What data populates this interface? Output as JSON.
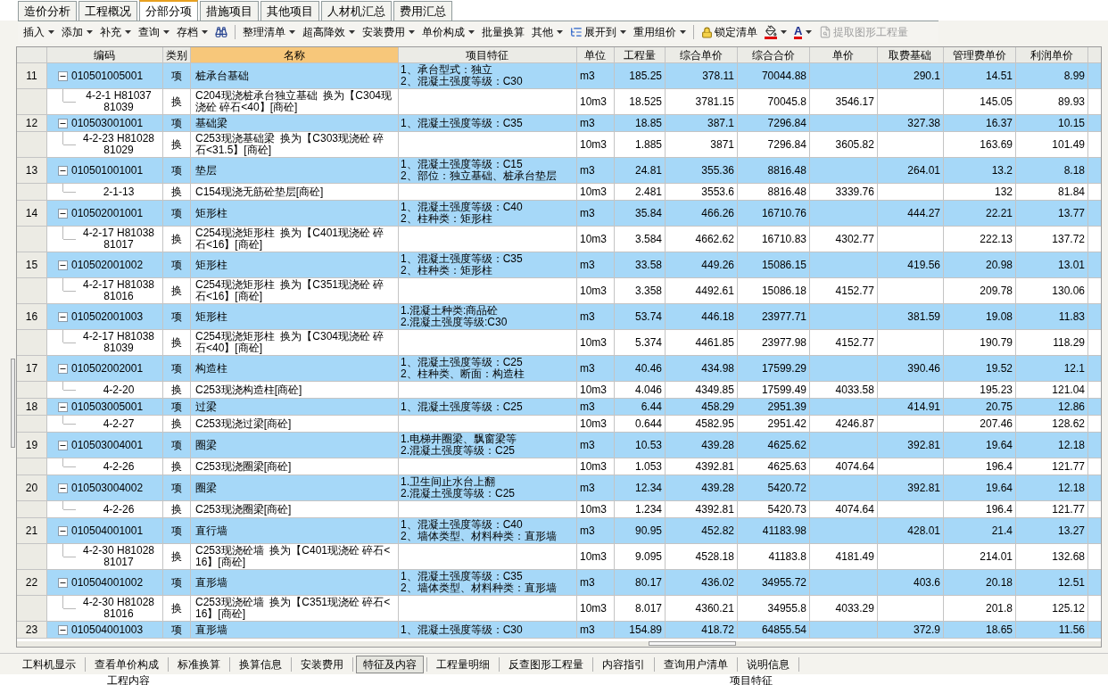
{
  "tabs": [
    {
      "label": "造价分析",
      "selected": false
    },
    {
      "label": "工程概况",
      "selected": false
    },
    {
      "label": "分部分项",
      "selected": true
    },
    {
      "label": "措施项目",
      "selected": false
    },
    {
      "label": "其他项目",
      "selected": false
    },
    {
      "label": "人材机汇总",
      "selected": false
    },
    {
      "label": "费用汇总",
      "selected": false
    }
  ],
  "toolbar": [
    {
      "kind": "text",
      "label": "插入",
      "menu": true
    },
    {
      "kind": "text",
      "label": "添加",
      "menu": true
    },
    {
      "kind": "text",
      "label": "补充",
      "menu": true
    },
    {
      "kind": "text",
      "label": "查询",
      "menu": true
    },
    {
      "kind": "text",
      "label": "存档",
      "menu": true
    },
    {
      "kind": "find",
      "menu": false
    },
    {
      "kind": "separator"
    },
    {
      "kind": "text",
      "label": "整理清单",
      "menu": true
    },
    {
      "kind": "text",
      "label": "超高降效",
      "menu": true
    },
    {
      "kind": "text",
      "label": "安装费用",
      "menu": true
    },
    {
      "kind": "text",
      "label": "单价构成",
      "menu": true
    },
    {
      "kind": "text",
      "label": "批量换算",
      "menu": false
    },
    {
      "kind": "text",
      "label": "其他",
      "menu": true
    },
    {
      "kind": "expand",
      "label": "展开到",
      "menu": true
    },
    {
      "kind": "text",
      "label": "重用组价",
      "menu": true
    },
    {
      "kind": "separator"
    },
    {
      "kind": "lock",
      "label": "锁定清单",
      "menu": false
    },
    {
      "kind": "fill-color",
      "menu": true
    },
    {
      "kind": "font-color",
      "label": "A",
      "menu": true
    },
    {
      "kind": "extract",
      "label": "提取图形工程量",
      "menu": false,
      "disabled": true
    }
  ],
  "table": {
    "columns": [
      {
        "selected": false
      },
      {
        "label": "编码",
        "selected": false
      },
      {
        "label": "类别",
        "selected": false
      },
      {
        "label": "名称",
        "selected": true
      },
      {
        "label": "项目特征",
        "selected": false
      },
      {
        "label": "单位",
        "selected": false
      },
      {
        "label": "工程量",
        "selected": false
      },
      {
        "label": "综合单价",
        "selected": false
      },
      {
        "label": "综合合价",
        "selected": false
      },
      {
        "label": "单价",
        "selected": false
      },
      {
        "label": "取费基础",
        "selected": false
      },
      {
        "label": "管理费单价",
        "selected": false
      },
      {
        "label": "利润单价",
        "selected": false
      }
    ],
    "rows": [
      {
        "number": "11",
        "code": "010501005001",
        "type": "项",
        "name": "桩承台基础",
        "features": [
          "1、承台型式：独立",
          "2、混凝土强度等级：C30"
        ],
        "unit": "m3",
        "quantity": "185.25",
        "unit_price": "378.11",
        "total": "70044.88",
        "fee_base": "290.1",
        "mgmt_fee": "14.51",
        "profit": "8.99",
        "expanded": true,
        "children": [
          {
            "code": "4-2-1 H81037 81039",
            "type": "换",
            "name": "C204现浇桩承台独立基础  换为【C304现浇砼 碎石<40】[商砼]",
            "unit": "10m3",
            "quantity": "18.525",
            "unit_price": "3781.15",
            "total": "70045.8",
            "price": "3546.17",
            "mgmt_fee": "145.05",
            "profit": "89.93"
          }
        ]
      },
      {
        "number": "12",
        "code": "010503001001",
        "type": "项",
        "name": "基础梁",
        "features": [
          "1、混凝土强度等级：C35"
        ],
        "unit": "m3",
        "quantity": "18.85",
        "unit_price": "387.1",
        "total": "7296.84",
        "fee_base": "327.38",
        "mgmt_fee": "16.37",
        "profit": "10.15",
        "expanded": true,
        "children": [
          {
            "code": "4-2-23 H81028 81029",
            "type": "换",
            "name": "C253现浇基础梁  换为【C303现浇砼 碎石<31.5】[商砼]",
            "unit": "10m3",
            "quantity": "1.885",
            "unit_price": "3871",
            "total": "7296.84",
            "price": "3605.82",
            "mgmt_fee": "163.69",
            "profit": "101.49"
          }
        ]
      },
      {
        "number": "13",
        "code": "010501001001",
        "type": "项",
        "name": "垫层",
        "features": [
          "1、混凝土强度等级：C15",
          "2、部位：独立基础、桩承台垫层"
        ],
        "unit": "m3",
        "quantity": "24.81",
        "unit_price": "355.36",
        "total": "8816.48",
        "fee_base": "264.01",
        "mgmt_fee": "13.2",
        "profit": "8.18",
        "expanded": true,
        "children": [
          {
            "code": "2-1-13",
            "type": "换",
            "name": "C154现浇无筋砼垫层[商砼]",
            "unit": "10m3",
            "quantity": "2.481",
            "unit_price": "3553.6",
            "total": "8816.48",
            "price": "3339.76",
            "mgmt_fee": "132",
            "profit": "81.84"
          }
        ]
      },
      {
        "number": "14",
        "code": "010502001001",
        "type": "项",
        "name": "矩形柱",
        "features": [
          "1、混凝土强度等级：C40",
          "2、柱种类：矩形柱"
        ],
        "unit": "m3",
        "quantity": "35.84",
        "unit_price": "466.26",
        "total": "16710.76",
        "fee_base": "444.27",
        "mgmt_fee": "22.21",
        "profit": "13.77",
        "expanded": true,
        "children": [
          {
            "code": "4-2-17 H81038 81017",
            "type": "换",
            "name": "C254现浇矩形柱  换为【C401现浇砼 碎石<16】[商砼]",
            "unit": "10m3",
            "quantity": "3.584",
            "unit_price": "4662.62",
            "total": "16710.83",
            "price": "4302.77",
            "mgmt_fee": "222.13",
            "profit": "137.72"
          }
        ]
      },
      {
        "number": "15",
        "code": "010502001002",
        "type": "项",
        "name": "矩形柱",
        "features": [
          "1、混凝土强度等级：C35",
          "2、柱种类：矩形柱"
        ],
        "unit": "m3",
        "quantity": "33.58",
        "unit_price": "449.26",
        "total": "15086.15",
        "fee_base": "419.56",
        "mgmt_fee": "20.98",
        "profit": "13.01",
        "expanded": true,
        "children": [
          {
            "code": "4-2-17 H81038 81016",
            "type": "换",
            "name": "C254现浇矩形柱  换为【C351现浇砼 碎石<16】[商砼]",
            "unit": "10m3",
            "quantity": "3.358",
            "unit_price": "4492.61",
            "total": "15086.18",
            "price": "4152.77",
            "mgmt_fee": "209.78",
            "profit": "130.06"
          }
        ]
      },
      {
        "number": "16",
        "code": "010502001003",
        "type": "项",
        "name": "矩形柱",
        "features": [
          "1.混凝土种类:商品砼",
          "2.混凝土强度等级:C30"
        ],
        "unit": "m3",
        "quantity": "53.74",
        "unit_price": "446.18",
        "total": "23977.71",
        "fee_base": "381.59",
        "mgmt_fee": "19.08",
        "profit": "11.83",
        "expanded": true,
        "children": [
          {
            "code": "4-2-17 H81038 81039",
            "type": "换",
            "name": "C254现浇矩形柱  换为【C304现浇砼 碎石<40】[商砼]",
            "unit": "10m3",
            "quantity": "5.374",
            "unit_price": "4461.85",
            "total": "23977.98",
            "price": "4152.77",
            "mgmt_fee": "190.79",
            "profit": "118.29"
          }
        ]
      },
      {
        "number": "17",
        "code": "010502002001",
        "type": "项",
        "name": "构造柱",
        "features": [
          "1、混凝土强度等级：C25",
          "2、柱种类、断面：构造柱"
        ],
        "unit": "m3",
        "quantity": "40.46",
        "unit_price": "434.98",
        "total": "17599.29",
        "fee_base": "390.46",
        "mgmt_fee": "19.52",
        "profit": "12.1",
        "expanded": true,
        "children": [
          {
            "code": "4-2-20",
            "type": "换",
            "name": "C253现浇构造柱[商砼]",
            "unit": "10m3",
            "quantity": "4.046",
            "unit_price": "4349.85",
            "total": "17599.49",
            "price": "4033.58",
            "mgmt_fee": "195.23",
            "profit": "121.04"
          }
        ]
      },
      {
        "number": "18",
        "code": "010503005001",
        "type": "项",
        "name": "过梁",
        "features": [
          "1、混凝土强度等级：C25"
        ],
        "unit": "m3",
        "quantity": "6.44",
        "unit_price": "458.29",
        "total": "2951.39",
        "fee_base": "414.91",
        "mgmt_fee": "20.75",
        "profit": "12.86",
        "expanded": true,
        "children": [
          {
            "code": "4-2-27",
            "type": "换",
            "name": "C253现浇过梁[商砼]",
            "unit": "10m3",
            "quantity": "0.644",
            "unit_price": "4582.95",
            "total": "2951.42",
            "price": "4246.87",
            "mgmt_fee": "207.46",
            "profit": "128.62"
          }
        ]
      },
      {
        "number": "19",
        "code": "010503004001",
        "type": "项",
        "name": "圈梁",
        "features": [
          "1.电梯井圈梁、飘窗梁等",
          "2.混凝土强度等级：C25"
        ],
        "unit": "m3",
        "quantity": "10.53",
        "unit_price": "439.28",
        "total": "4625.62",
        "fee_base": "392.81",
        "mgmt_fee": "19.64",
        "profit": "12.18",
        "expanded": true,
        "children": [
          {
            "code": "4-2-26",
            "type": "换",
            "name": "C253现浇圈梁[商砼]",
            "unit": "10m3",
            "quantity": "1.053",
            "unit_price": "4392.81",
            "total": "4625.63",
            "price": "4074.64",
            "mgmt_fee": "196.4",
            "profit": "121.77"
          }
        ]
      },
      {
        "number": "20",
        "code": "010503004002",
        "type": "项",
        "name": "圈梁",
        "features": [
          "1.卫生间止水台上翻",
          "2.混凝土强度等级：C25"
        ],
        "unit": "m3",
        "quantity": "12.34",
        "unit_price": "439.28",
        "total": "5420.72",
        "fee_base": "392.81",
        "mgmt_fee": "19.64",
        "profit": "12.18",
        "expanded": true,
        "children": [
          {
            "code": "4-2-26",
            "type": "换",
            "name": "C253现浇圈梁[商砼]",
            "unit": "10m3",
            "quantity": "1.234",
            "unit_price": "4392.81",
            "total": "5420.73",
            "price": "4074.64",
            "mgmt_fee": "196.4",
            "profit": "121.77"
          }
        ]
      },
      {
        "number": "21",
        "code": "010504001001",
        "type": "项",
        "name": "直行墙",
        "features": [
          "1、混凝土强度等级：C40",
          "2、墙体类型、材料种类：直形墙"
        ],
        "unit": "m3",
        "quantity": "90.95",
        "unit_price": "452.82",
        "total": "41183.98",
        "fee_base": "428.01",
        "mgmt_fee": "21.4",
        "profit": "13.27",
        "expanded": true,
        "children": [
          {
            "code": "4-2-30 H81028 81017",
            "type": "换",
            "name": "C253现浇砼墙  换为【C401现浇砼 碎石<16】[商砼]",
            "unit": "10m3",
            "quantity": "9.095",
            "unit_price": "4528.18",
            "total": "41183.8",
            "price": "4181.49",
            "mgmt_fee": "214.01",
            "profit": "132.68"
          }
        ]
      },
      {
        "number": "22",
        "code": "010504001002",
        "type": "项",
        "name": "直形墙",
        "features": [
          "1、混凝土强度等级：C35",
          "2、墙体类型、材料种类：直形墙"
        ],
        "unit": "m3",
        "quantity": "80.17",
        "unit_price": "436.02",
        "total": "34955.72",
        "fee_base": "403.6",
        "mgmt_fee": "20.18",
        "profit": "12.51",
        "expanded": true,
        "children": [
          {
            "code": "4-2-30 H81028 81016",
            "type": "换",
            "name": "C253现浇砼墙  换为【C351现浇砼 碎石<16】[商砼]",
            "unit": "10m3",
            "quantity": "8.017",
            "unit_price": "4360.21",
            "total": "34955.8",
            "price": "4033.29",
            "mgmt_fee": "201.8",
            "profit": "125.12"
          }
        ]
      },
      {
        "number": "23",
        "code": "010504001003",
        "type": "项",
        "name": "直形墙",
        "features": [
          "1、混凝土强度等级：C30"
        ],
        "unit": "m3",
        "quantity": "154.89",
        "unit_price": "418.72",
        "total": "64855.54",
        "fee_base": "372.9",
        "mgmt_fee": "18.65",
        "profit": "11.56",
        "expanded": true
      }
    ]
  },
  "bottom_tabs": [
    {
      "label": "工料机显示",
      "selected": false
    },
    {
      "label": "查看单价构成",
      "selected": false
    },
    {
      "label": "标准换算",
      "selected": false
    },
    {
      "label": "换算信息",
      "selected": false
    },
    {
      "label": "安装费用",
      "selected": false
    },
    {
      "label": "特征及内容",
      "selected": true
    },
    {
      "label": "工程量明细",
      "selected": false
    },
    {
      "label": "反查图形工程量",
      "selected": false
    },
    {
      "label": "内容指引",
      "selected": false
    },
    {
      "label": "查询用户清单",
      "selected": false
    },
    {
      "label": "说明信息",
      "selected": false
    }
  ],
  "bottom_panels": [
    {
      "title": "工程内容"
    },
    {
      "title": "项目特征"
    }
  ]
}
